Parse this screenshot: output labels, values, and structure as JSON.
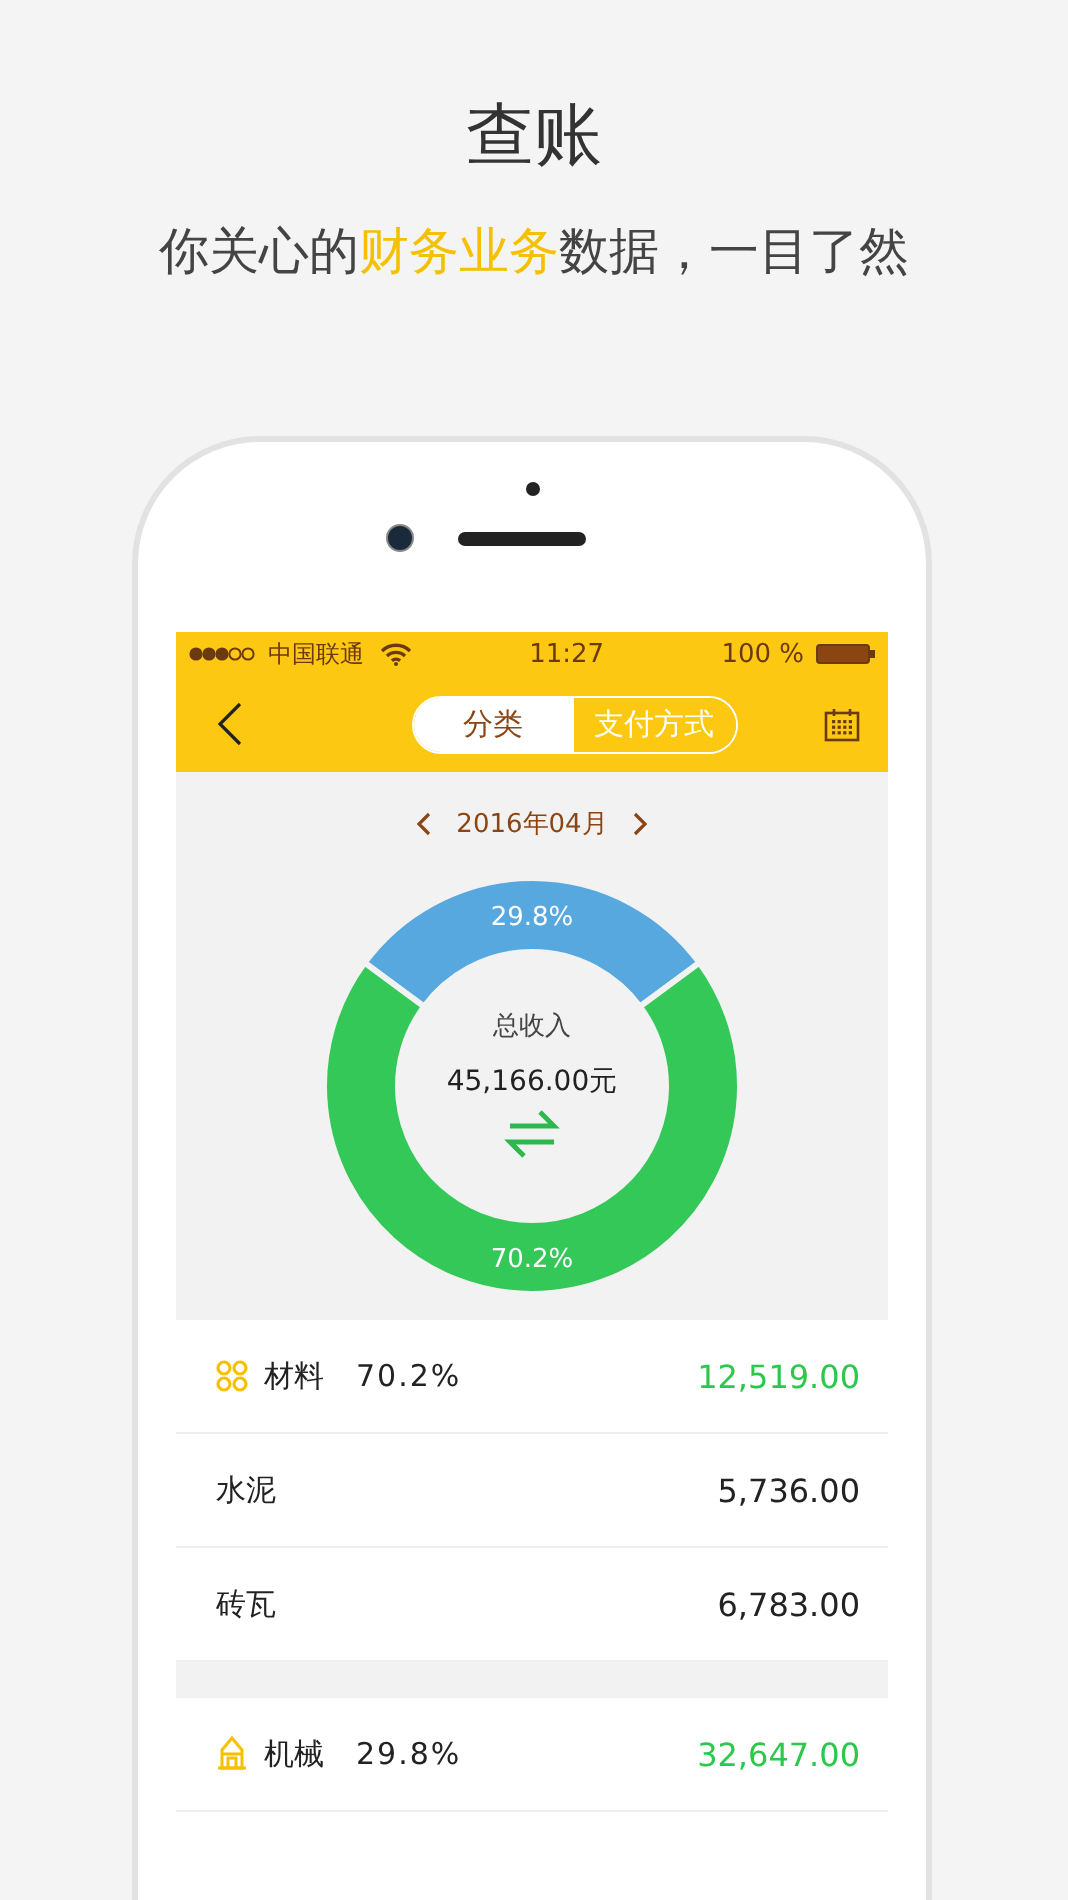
{
  "headline": {
    "title": "查账",
    "subtitle": [
      {
        "text": "你关心的",
        "highlight": false
      },
      {
        "text": "财务业务",
        "highlight": true
      },
      {
        "text": "数据，一目了然",
        "highlight": false
      }
    ]
  },
  "status_bar": {
    "carrier": "中国联通",
    "time": "11:27",
    "battery": "100 %"
  },
  "nav": {
    "segments": [
      {
        "label": "分类",
        "selected": true
      },
      {
        "label": "支付方式",
        "selected": false
      }
    ]
  },
  "month": "2016年04月",
  "summary": {
    "label": "总收入",
    "total": "45,166.00元",
    "chart_data": {
      "type": "donut",
      "values": [
        29.8,
        70.2
      ],
      "value_labels": [
        "29.8%",
        "70.2%"
      ]
    }
  },
  "groups": [
    {
      "name": "材料",
      "percent": "70.2%",
      "amount": "12,519.00",
      "items": [
        {
          "name": "水泥",
          "amount": "5,736.00"
        },
        {
          "name": "砖瓦",
          "amount": "6,783.00"
        }
      ]
    },
    {
      "name": "机械",
      "percent": "29.8%",
      "amount": "32,647.00"
    }
  ]
}
